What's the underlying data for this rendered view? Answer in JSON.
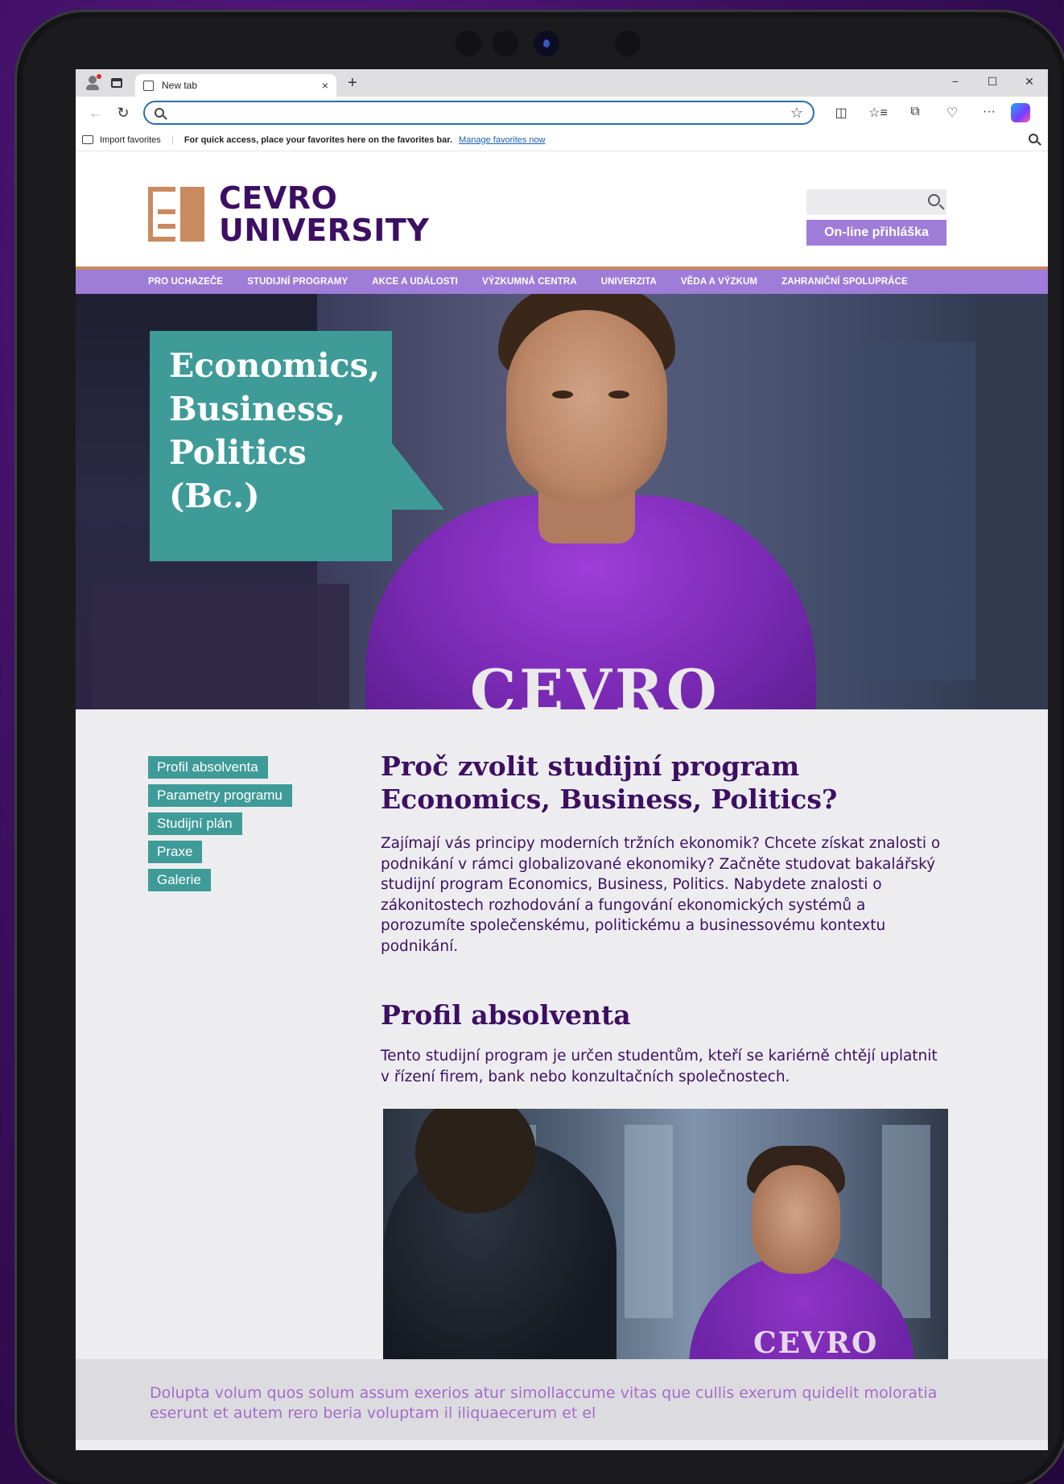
{
  "browser": {
    "tab_title": "New tab",
    "close": "×",
    "new_tab": "+",
    "minimize": "−",
    "maximize": "☐",
    "close_window": "✕",
    "back": "←",
    "refresh": "↻",
    "star": "☆",
    "address_value": "",
    "tools": [
      "◫",
      "☆≡",
      "⧉",
      "♡",
      "···"
    ],
    "import_favorites": "Import favorites",
    "favbar_message": "For quick access, place your favorites here on the favorites bar.",
    "favbar_link": "Manage favorites now"
  },
  "site": {
    "logo_line1": "CEVRO",
    "logo_line2": "UNIVERSITY",
    "search_placeholder": "",
    "online_button": "On-line přihláška",
    "nav": [
      "PRO UCHAZEČE",
      "STUDIJNÍ PROGRAMY",
      "AKCE A UDÁLOSTI",
      "VÝZKUMNÁ CENTRA",
      "UNIVERZITA",
      "VĚDA A VÝZKUM",
      "ZAHRANIČNÍ SPOLUPRÁCE"
    ],
    "hero_title": "Economics, Business, Politics (Bc.)",
    "hero_shirt": "CEVRO",
    "sidenav": [
      "Profil absolventa",
      "Parametry programu",
      "Studijní plán",
      "Praxe",
      "Galerie"
    ],
    "article": {
      "heading1": "Proč zvolit studijní program Economics, Business, Politics?",
      "paragraph1": "Zajímají vás principy moderních tržních ekonomik? Chcete získat znalosti o podnikání v rámci globalizované ekonomiky? Začněte studovat bakalářský studijní program Economics, Business, Politics. Nabydete znalosti o zákonitostech rozhodování a fungování ekonomických systémů a porozumíte společenskému, politickému a businessovému kontextu podnikání.",
      "heading2": "Profil absolventa",
      "paragraph2": "Tento studijní program je určen studentům, kteří se kariérně chtějí uplatnit v řízení firem, bank nebo konzultačních společnostech.",
      "photo_shirt": "CEVRO"
    },
    "footer_text": "Dolupta volum quos solum assum exerios atur simollaccume vitas que cullis exerum quidelit moloratia eserunt et autem rero beria voluptam il iliquaecerum et el"
  },
  "colors": {
    "brand_purple": "#3d0f63",
    "accent_lavender": "#9e7cd8",
    "accent_teal": "#3e9b98",
    "accent_copper": "#c98a5f"
  }
}
